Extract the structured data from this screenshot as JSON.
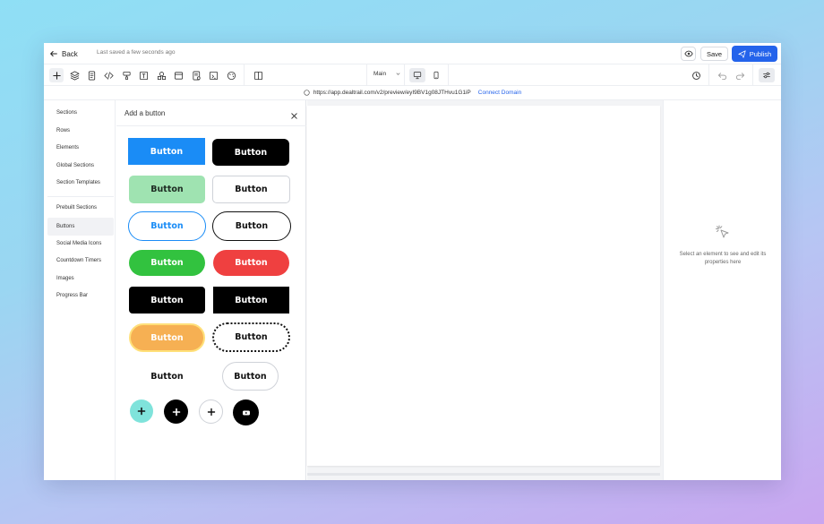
{
  "topbar": {
    "back_label": "Back",
    "saved_status": "Last saved a few seconds ago",
    "save_label": "Save",
    "publish_label": "Publish"
  },
  "toolbar": {
    "icons": [
      "plus-icon",
      "layers-icon",
      "page-icon",
      "code-icon",
      "paint-icon",
      "text-icon",
      "shapes-icon",
      "browser-icon",
      "form-icon",
      "image-icon",
      "palette-icon",
      "columns-icon"
    ],
    "page_selector": "Main",
    "devices": [
      "desktop-icon",
      "mobile-icon"
    ]
  },
  "urlbar": {
    "url": "https://app.dealtrail.com/v2/preview/eyI9BV1g08JTHvu1G1iP",
    "connect_label": "Connect Domain"
  },
  "sidebar": {
    "items": [
      "Sections",
      "Rows",
      "Elements",
      "Global Sections",
      "Section Templates"
    ],
    "items2": [
      "Prebuilt Sections",
      "Buttons",
      "Social Media Icons",
      "Countdown Timers",
      "Images",
      "Progress Bar"
    ],
    "active": "Buttons"
  },
  "panel": {
    "title": "Add a button",
    "button_label": "Button",
    "colors": {
      "blue": "#1a8cf6",
      "green_light": "#9fe3b1",
      "green": "#32c23f",
      "red": "#ef4040",
      "orange": "#f6b053",
      "teal": "#7fe3db",
      "black": "#000000"
    }
  },
  "props": {
    "empty_text": "Select an element to see and edit its properties here"
  },
  "accent": "#2463eb"
}
